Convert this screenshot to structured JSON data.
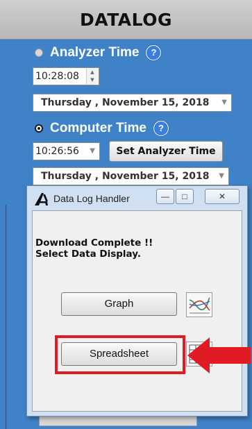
{
  "header": {
    "title": "DATALOG"
  },
  "analyzer": {
    "radio_label": "Analyzer Time",
    "help": "?",
    "time": "10:28:08",
    "date": "Thursday  , November  15, 2018"
  },
  "computer": {
    "radio_label": "Computer Time",
    "help": "?",
    "time": "10:26:56",
    "date": "Thursday  , November  15, 2018",
    "set_button": "Set Analyzer Time"
  },
  "dialog": {
    "title": "Data Log Handler",
    "message_line1": "Download Complete !!",
    "message_line2": "Select Data Display.",
    "graph_button": "Graph",
    "spreadsheet_button": "Spreadsheet",
    "minimize": "—",
    "maximize": "□",
    "close": "✕",
    "icons": {
      "graph": "line-graph-icon",
      "spreadsheet": "spreadsheet-icon",
      "app": "app-logo-icon"
    }
  },
  "colors": {
    "panel": "#3f82c8",
    "highlight": "#e01b24",
    "header": "#c4c4c4"
  }
}
